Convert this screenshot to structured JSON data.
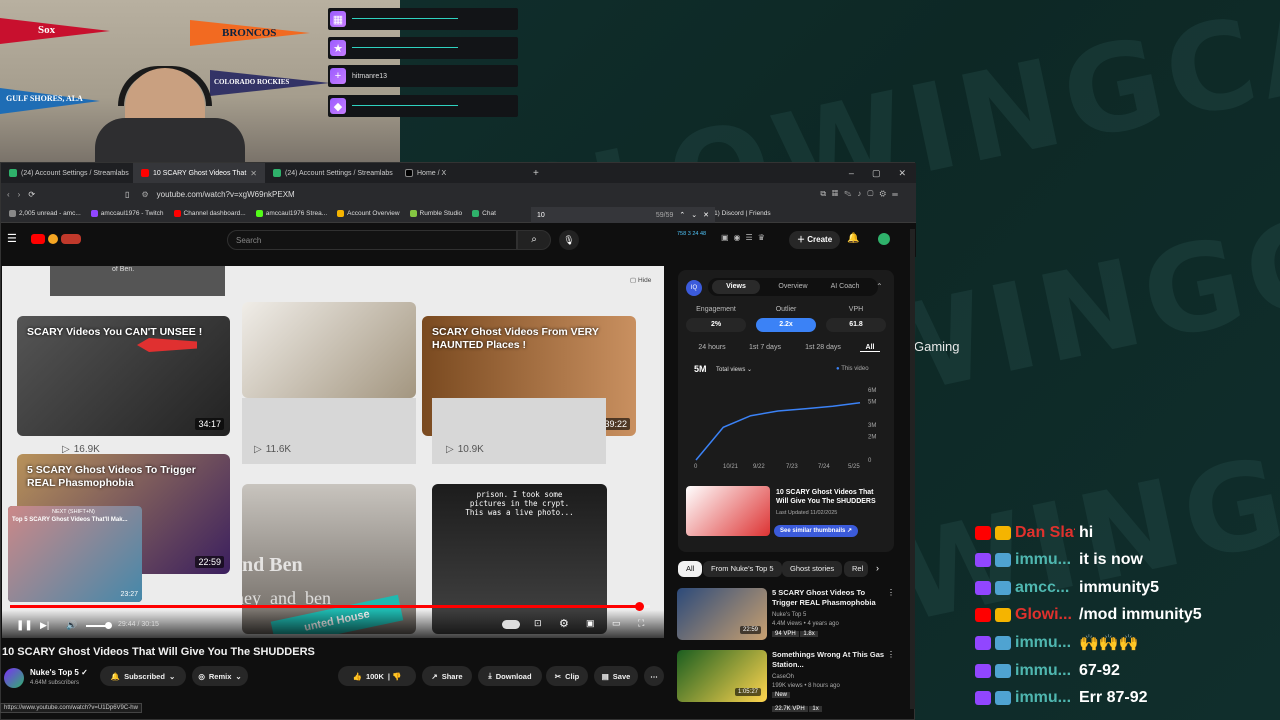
{
  "overlay": {
    "alerts": [
      "",
      "",
      "hitmanre13",
      ""
    ],
    "watermark": "GLOWINGCARD",
    "gaming_text": "Gaming"
  },
  "webcam": {
    "pennants": [
      "Sox",
      "BRONCOS",
      "GULF SHORES, ALA",
      "COLORADO ROCKIES"
    ]
  },
  "browser": {
    "tabs": [
      {
        "label": "(24) Account Settings / Streamlabs",
        "active": false
      },
      {
        "label": "10 SCARY Ghost Videos That",
        "active": true
      },
      {
        "label": "(24) Account Settings / Streamlabs",
        "active": false
      },
      {
        "label": "Home / X",
        "active": false
      }
    ],
    "url": "youtube.com/watch?v=xgW69nkPEXM",
    "find_query": "10",
    "find_count": "59/59",
    "bookmarks": [
      "2,005 unread - amc...",
      "amccaul1976 - Twitch",
      "Channel dashboard...",
      "amccaul1976 Strea...",
      "Account Overview",
      "Rumble Studio",
      "Chat",
      "(1) Discord | Friends"
    ],
    "status_url": "https://www.youtube.com/watch?v=U1Dp6V9C-hw"
  },
  "youtube": {
    "search_placeholder": "Search",
    "create_label": "Create",
    "stats_mini": [
      "758",
      "3",
      "24",
      "48"
    ],
    "video": {
      "title": "10 SCARY Ghost Videos That Will Give You The SHUDDERS",
      "time": "29:44 / 30:15",
      "progress": 0.983,
      "hide_label": "Hide",
      "grid": [
        {
          "title": "SCARY Videos You CAN'T UNSEE !",
          "duration": "34:17",
          "views": "16.9K"
        },
        {
          "title": "",
          "duration": "",
          "views": "11.6K"
        },
        {
          "title": "SCARY Ghost Videos From VERY HAUNTED Places !",
          "duration": "39:22",
          "views": "10.9K"
        },
        {
          "title": "5 SCARY Ghost Videos To Trigger REAL Phasmophobia",
          "duration": "22:59",
          "views": ""
        },
        {
          "title": "",
          "duration": "",
          "views": ""
        },
        {
          "title": "",
          "duration": "",
          "views": ""
        }
      ],
      "top_caption": "of Ben.",
      "caption_6": "prison. I took some pictures in the crypt. This was a live photo...",
      "overlay_text_1": "and Ben",
      "overlay_text_2": "ainey_and_ben",
      "overlay_text_3": "unted House",
      "next_label": "NEXT (SHIFT+N)",
      "next_title": "Top 5 SCARY Ghost Videos That'll Mak...",
      "next_duration": "23:27"
    },
    "channel": {
      "name": "Nuke's Top 5",
      "subscribers": "4.64M subscribers",
      "subscribed_label": "Subscribed",
      "remix_label": "Remix"
    },
    "actions": {
      "likes": "100K",
      "share": "Share",
      "download": "Download",
      "clip": "Clip",
      "save": "Save"
    },
    "analytics": {
      "tabs": [
        "Views",
        "Overview",
        "AI Coach"
      ],
      "metrics": [
        {
          "label": "Engagement",
          "value": "2%"
        },
        {
          "label": "Outlier",
          "value": "2.2x"
        },
        {
          "label": "VPH",
          "value": "61.8"
        }
      ],
      "ranges": [
        "24 hours",
        "1st 7 days",
        "1st 28 days",
        "All"
      ],
      "total": "5M",
      "total_label": "Total views",
      "legend": "This video",
      "chart_data": {
        "type": "line",
        "x": [
          "0",
          "10/21",
          "9/22",
          "7/23",
          "7/24",
          "5/25"
        ],
        "y_ticks": [
          "6M",
          "5M",
          "3M",
          "2M",
          "0"
        ],
        "series": [
          {
            "values": [
              0,
              2.8,
              3.8,
              4.2,
              4.4,
              4.6,
              4.9
            ]
          }
        ]
      },
      "promo_title": "10 SCARY Ghost Videos That Will Give You The SHUDDERS",
      "promo_updated": "Last Updated 11/02/2025",
      "similar_label": "See similar thumbnails"
    },
    "chips": [
      "All",
      "From Nuke's Top 5",
      "Ghost stories",
      "Rel"
    ],
    "recommended": [
      {
        "title": "5 SCARY Ghost Videos To Trigger REAL Phasmophobia",
        "channel": "Nuke's Top 5",
        "meta": "4.4M views • 4 years ago",
        "vph": "94 VPH",
        "mult": "1.8x",
        "duration": "22:59"
      },
      {
        "title": "Somethings Wrong At This Gas Station...",
        "channel": "CaseOh",
        "meta": "199K views • 8 hours ago",
        "badge": "New",
        "vph": "22.7K VPH",
        "mult": "1x",
        "duration": "1:05:27"
      }
    ]
  },
  "chat": [
    {
      "name": "Dan Slat...",
      "msg": "hi",
      "platform": "youtube",
      "color": "#e0312d"
    },
    {
      "name": "immu...",
      "msg": "it is now",
      "platform": "twitch",
      "color": "#4fb7b0"
    },
    {
      "name": "amcc...",
      "msg": "immunity5",
      "platform": "twitch",
      "color": "#4fb7b0"
    },
    {
      "name": "Glowi...",
      "msg": "/mod immunity5",
      "platform": "youtube",
      "color": "#e0312d"
    },
    {
      "name": "immu...",
      "msg": "🙌🙌🙌",
      "platform": "twitch",
      "color": "#4fb7b0"
    },
    {
      "name": "immu...",
      "msg": "67-92",
      "platform": "twitch",
      "color": "#4fb7b0"
    },
    {
      "name": "immu...",
      "msg": "Err 87-92",
      "platform": "twitch",
      "color": "#4fb7b0"
    }
  ],
  "colors": {
    "accent": "#ff0000",
    "teal": "#2fd2c0",
    "purple": "#9146ff"
  }
}
